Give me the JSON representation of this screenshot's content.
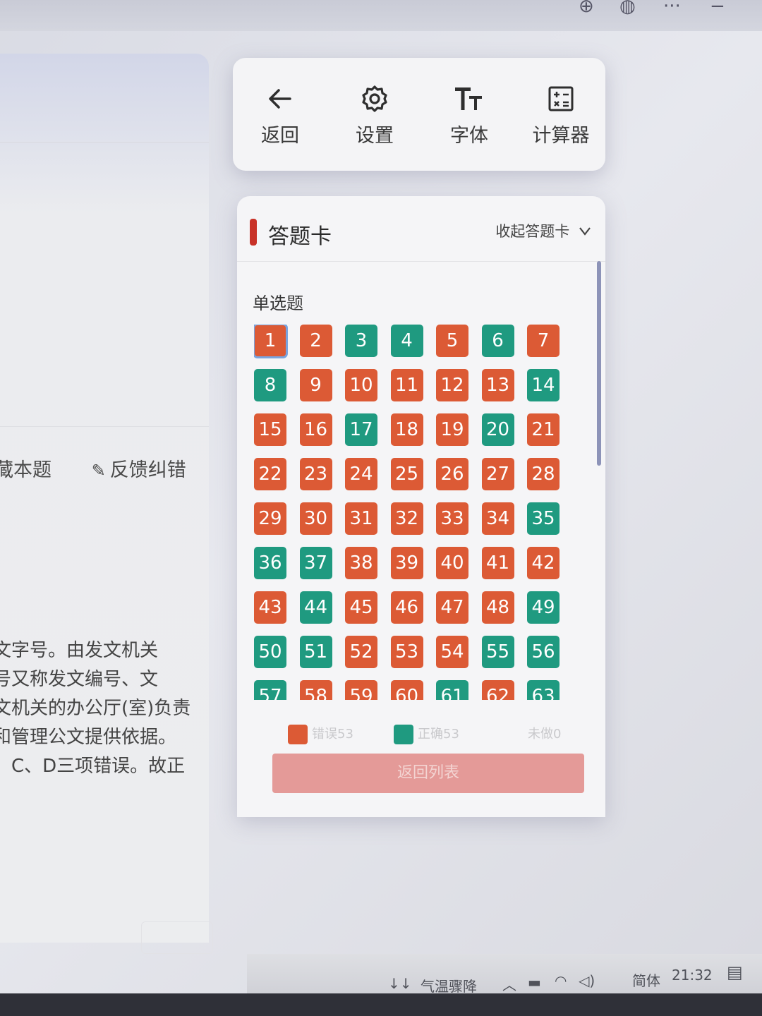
{
  "toolbar": {
    "items": [
      {
        "label": "返回",
        "icon": "arrow-left-icon"
      },
      {
        "label": "设置",
        "icon": "gear-icon"
      },
      {
        "label": "字体",
        "icon": "font-size-icon"
      },
      {
        "label": "计算器",
        "icon": "calculator-icon"
      }
    ]
  },
  "answer_card": {
    "title": "答题卡",
    "collapse_label": "收起答题卡",
    "collapse_icon": "chevron-down-icon",
    "section": "单选题",
    "colors": {
      "wrong": "#dc5a35",
      "right": "#1f9a80",
      "current_outline": "#7aa4de"
    },
    "current": 1,
    "questions": [
      {
        "n": "1",
        "s": "wrong"
      },
      {
        "n": "2",
        "s": "wrong"
      },
      {
        "n": "3",
        "s": "right"
      },
      {
        "n": "4",
        "s": "right"
      },
      {
        "n": "5",
        "s": "wrong"
      },
      {
        "n": "6",
        "s": "right"
      },
      {
        "n": "7",
        "s": "wrong"
      },
      {
        "n": "8",
        "s": "right"
      },
      {
        "n": "9",
        "s": "wrong"
      },
      {
        "n": "10",
        "s": "wrong"
      },
      {
        "n": "11",
        "s": "wrong"
      },
      {
        "n": "12",
        "s": "wrong"
      },
      {
        "n": "13",
        "s": "wrong"
      },
      {
        "n": "14",
        "s": "right"
      },
      {
        "n": "15",
        "s": "wrong"
      },
      {
        "n": "16",
        "s": "wrong"
      },
      {
        "n": "17",
        "s": "right"
      },
      {
        "n": "18",
        "s": "wrong"
      },
      {
        "n": "19",
        "s": "wrong"
      },
      {
        "n": "20",
        "s": "right"
      },
      {
        "n": "21",
        "s": "wrong"
      },
      {
        "n": "22",
        "s": "wrong"
      },
      {
        "n": "23",
        "s": "wrong"
      },
      {
        "n": "24",
        "s": "wrong"
      },
      {
        "n": "25",
        "s": "wrong"
      },
      {
        "n": "26",
        "s": "wrong"
      },
      {
        "n": "27",
        "s": "wrong"
      },
      {
        "n": "28",
        "s": "wrong"
      },
      {
        "n": "29",
        "s": "wrong"
      },
      {
        "n": "30",
        "s": "wrong"
      },
      {
        "n": "31",
        "s": "wrong"
      },
      {
        "n": "32",
        "s": "wrong"
      },
      {
        "n": "33",
        "s": "wrong"
      },
      {
        "n": "34",
        "s": "wrong"
      },
      {
        "n": "35",
        "s": "right"
      },
      {
        "n": "36",
        "s": "right"
      },
      {
        "n": "37",
        "s": "right"
      },
      {
        "n": "38",
        "s": "wrong"
      },
      {
        "n": "39",
        "s": "wrong"
      },
      {
        "n": "40",
        "s": "wrong"
      },
      {
        "n": "41",
        "s": "wrong"
      },
      {
        "n": "42",
        "s": "wrong"
      },
      {
        "n": "43",
        "s": "wrong"
      },
      {
        "n": "44",
        "s": "right"
      },
      {
        "n": "45",
        "s": "wrong"
      },
      {
        "n": "46",
        "s": "wrong"
      },
      {
        "n": "47",
        "s": "wrong"
      },
      {
        "n": "48",
        "s": "wrong"
      },
      {
        "n": "49",
        "s": "right"
      },
      {
        "n": "50",
        "s": "right"
      },
      {
        "n": "51",
        "s": "right"
      },
      {
        "n": "52",
        "s": "wrong"
      },
      {
        "n": "53",
        "s": "wrong"
      },
      {
        "n": "54",
        "s": "wrong"
      },
      {
        "n": "55",
        "s": "right"
      },
      {
        "n": "56",
        "s": "right"
      },
      {
        "n": "57",
        "s": "right"
      },
      {
        "n": "58",
        "s": "wrong"
      },
      {
        "n": "59",
        "s": "wrong"
      },
      {
        "n": "60",
        "s": "wrong"
      },
      {
        "n": "61",
        "s": "right"
      },
      {
        "n": "62",
        "s": "wrong"
      },
      {
        "n": "63",
        "s": "right"
      }
    ],
    "legend": {
      "wrong": "错误53",
      "right": "正确53",
      "unanswered": "未做0"
    },
    "back_list_label": "返回列表",
    "back_list_color": "#e49a98"
  },
  "left_panel": {
    "actions": {
      "collect": "藏本题",
      "feedback": "反馈纠错"
    },
    "explanation_lines": [
      "文字号。由发文机关",
      "号又称发文编号、文",
      "文机关的办公厅(室)负责",
      "和管理公文提供依据。",
      "、C、D三项错误。故正"
    ]
  },
  "taskbar": {
    "weather": "气温骤降",
    "ime": "简体",
    "time": "21:32"
  }
}
